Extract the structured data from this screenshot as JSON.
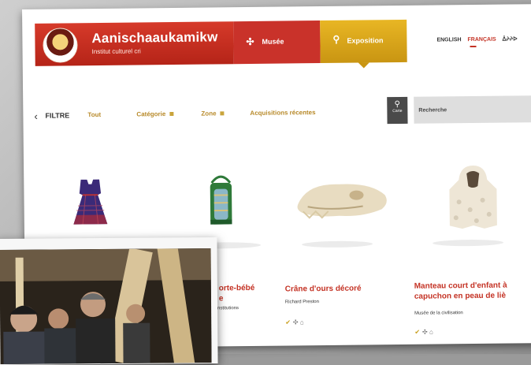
{
  "brand": {
    "name": "Aanischaaukamikw",
    "subtitle": "Institut culturel cri"
  },
  "nav": {
    "musee": "Musée",
    "exposition": "Exposition"
  },
  "languages": {
    "items": [
      "ENGLISH",
      "FRANÇAIS",
      "ᐄᔨᔨᐅ"
    ],
    "active": "FRANÇAIS"
  },
  "filters": {
    "label": "FILTRE",
    "items": [
      "Tout",
      "Catégorie",
      "Zone",
      "Acquisitions récentes"
    ]
  },
  "map": {
    "label": "Carte"
  },
  "search": {
    "placeholder": "Recherche"
  },
  "products": [
    {
      "title": "",
      "institution": ""
    },
    {
      "title_line1": "orte-bébé",
      "title_line2": "e",
      "institution": "nstitutions"
    },
    {
      "title": "Crâne d'ours décoré",
      "institution": "Richard Preston"
    },
    {
      "title_line1": "Manteau court d'enfant à",
      "title_line2": "capuchon en peau de liè",
      "institution": "Musée de la civilisation"
    }
  ],
  "colors": {
    "brand_red": "#c43325",
    "expo_gold": "#d9a51c",
    "filter_gold": "#b88a2a"
  },
  "icons": [
    "musee-compass-icon",
    "search-icon",
    "map-pin-icon",
    "checkmark-icon",
    "move-icon",
    "gallery-icon"
  ]
}
